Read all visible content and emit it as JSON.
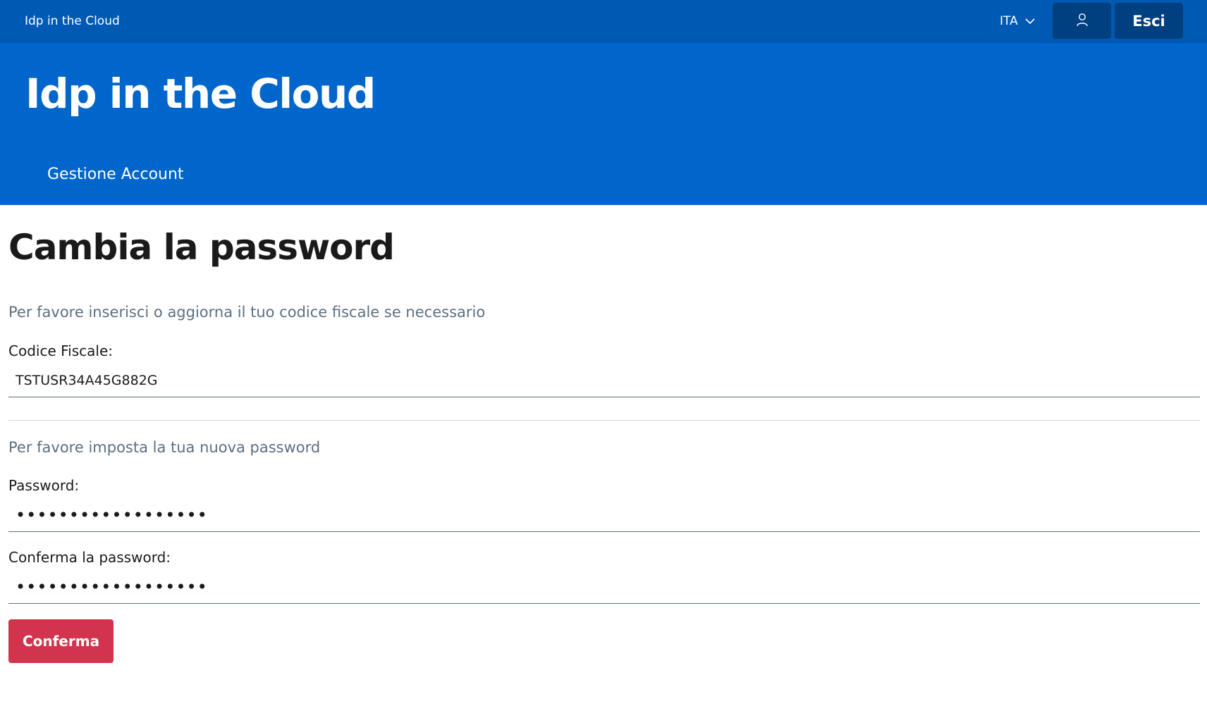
{
  "slim_header": {
    "brand": "Idp in the Cloud",
    "language": "ITA",
    "logout_label": "Esci",
    "user_icon": "user-icon",
    "chevron_icon": "chevron-down-icon"
  },
  "center_header": {
    "title": "Idp in the Cloud",
    "nav_item": "Gestione Account"
  },
  "main": {
    "page_title": "Cambia la password",
    "fiscal_section": {
      "lead": "Per favore inserisci o aggiorna il tuo codice fiscale se necessario",
      "label": "Codice Fiscale:",
      "value": "TSTUSR34A45G882G"
    },
    "password_section": {
      "lead": "Per favore imposta la tua nuova password",
      "password_label": "Password:",
      "password_value": "••••••••••••••••••",
      "confirm_label": "Conferma la password:",
      "confirm_value": "••••••••••••••••••"
    },
    "submit_label": "Conferma"
  },
  "colors": {
    "slim_header_bg": "#0059b3",
    "center_header_bg": "#0066cc",
    "button_dark": "#004080",
    "submit_bg": "#d1344c",
    "lead_text": "#5c6f82"
  }
}
